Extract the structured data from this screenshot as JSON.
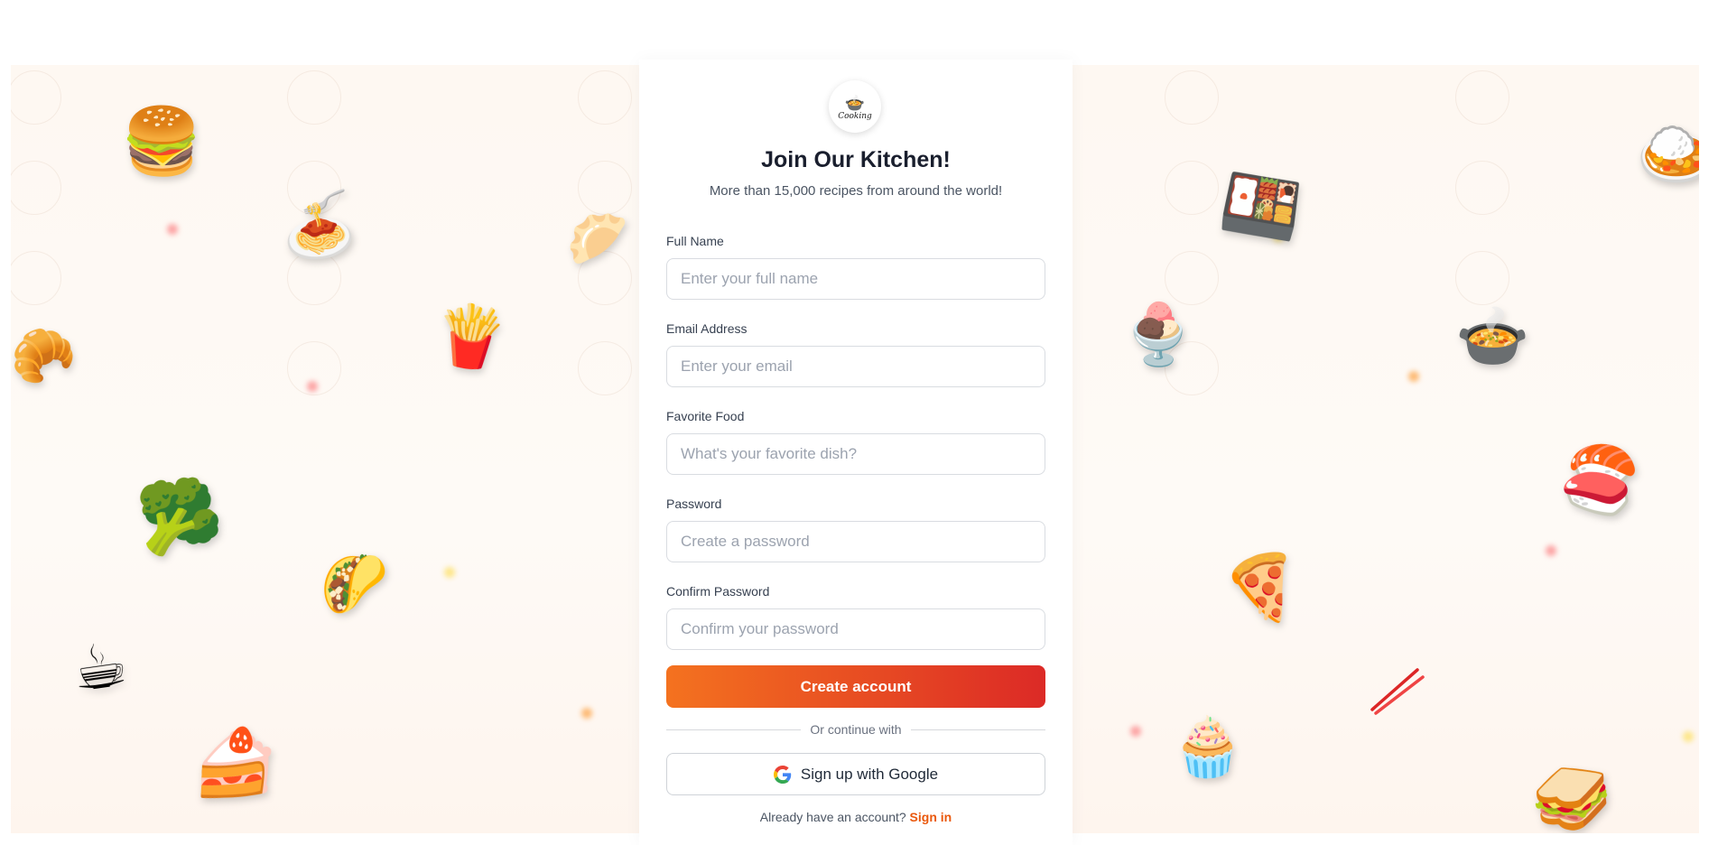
{
  "brand": {
    "logo_text": "Cooking",
    "logo_icon": "cooking-pot-icon"
  },
  "form": {
    "title": "Join Our Kitchen!",
    "subtitle": "More than 15,000 recipes from around the world!",
    "fields": [
      {
        "label": "Full Name",
        "placeholder": "Enter your full name",
        "type": "text"
      },
      {
        "label": "Email Address",
        "placeholder": "Enter your email",
        "type": "email"
      },
      {
        "label": "Favorite Food",
        "placeholder": "What's your favorite dish?",
        "type": "text"
      },
      {
        "label": "Password",
        "placeholder": "Create a password",
        "type": "password"
      },
      {
        "label": "Confirm Password",
        "placeholder": "Confirm your password",
        "type": "password"
      }
    ],
    "submit_label": "Create account",
    "divider_text": "Or continue with",
    "google_label": "Sign up with Google",
    "signin_prompt": "Already have an account?",
    "signin_link": "Sign in"
  },
  "colors": {
    "accent_start": "#f4721f",
    "accent_end": "#dc2a26",
    "link": "#ea580c",
    "background": "#fef8f2"
  },
  "decorations": {
    "food_icons": [
      "hamburger-icon",
      "spaghetti-icon",
      "dumpling-icon",
      "croissant-icon",
      "fries-icon",
      "broccoli-icon",
      "taco-icon",
      "coffee-icon",
      "cake-icon",
      "bento-icon",
      "ice-cream-icon",
      "stew-icon",
      "curry-rice-icon",
      "sushi-icon",
      "pizza-icon",
      "chopsticks-icon",
      "cupcake-icon",
      "sandwich-icon"
    ]
  }
}
